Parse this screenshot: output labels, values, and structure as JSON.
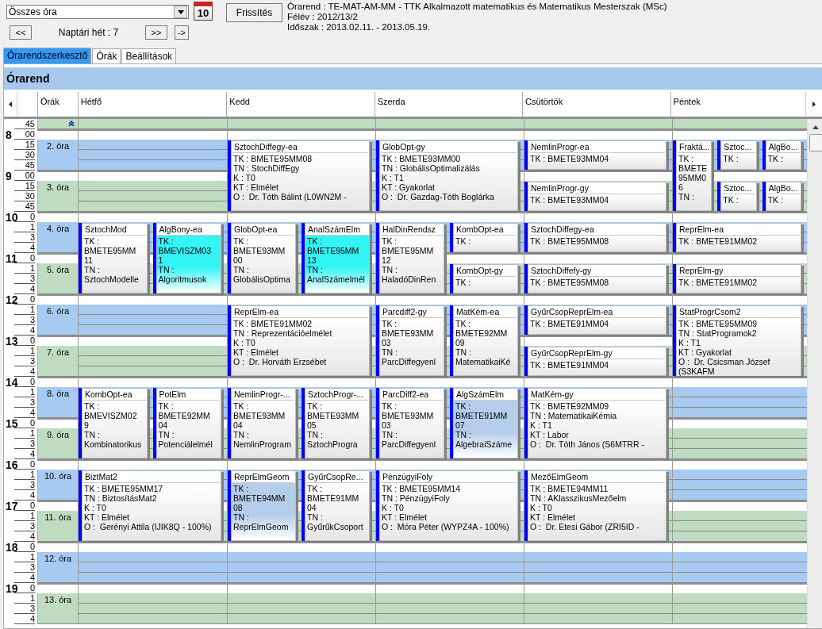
{
  "toolbar": {
    "filter": {
      "value": "Összes óra"
    },
    "calendar_button": {
      "label": "10"
    },
    "prev_button": "<<",
    "week_label": "Naptári hét : 7",
    "next_button": ">>",
    "go_button": "->",
    "refresh_button": "Frissítés",
    "info": [
      "Órarend : TE-MAT-AM-MM - TTK Alkalmazott matematikus és Matematikus Mesterszak (MSc)",
      "Félév : 2012/13/2",
      "Időszak : 2013.02.11. - 2013.05.19."
    ]
  },
  "tabs": [
    {
      "label": "Órarendszerkesztő",
      "selected": true
    },
    {
      "label": "Órák",
      "selected": false
    },
    {
      "label": "Beállítások",
      "selected": false
    }
  ],
  "panel_title": "Órarend",
  "columns": [
    "Órák",
    "Hétfő",
    "Kedd",
    "Szerda",
    "Csütörtök",
    "Péntek"
  ],
  "time_axis": [
    {
      "marks": [
        "45"
      ]
    },
    {
      "hour": "8",
      "marks": [
        "00",
        "15",
        "30",
        "45"
      ]
    },
    {
      "hour": "9",
      "marks": [
        "00",
        "15",
        "30",
        "45"
      ]
    },
    {
      "hour": "10",
      "marks": [
        "0",
        "1",
        "3",
        "4"
      ]
    },
    {
      "hour": "11",
      "marks": [
        "0",
        "1",
        "3",
        "4"
      ]
    },
    {
      "hour": "12",
      "marks": [
        "0",
        "1",
        "3",
        "4"
      ]
    },
    {
      "hour": "13",
      "marks": [
        "0",
        "1",
        "3",
        "4"
      ]
    },
    {
      "hour": "14",
      "marks": [
        "0",
        "1",
        "3",
        "4"
      ]
    },
    {
      "hour": "15",
      "marks": [
        "0",
        "1",
        "3",
        "4"
      ]
    },
    {
      "hour": "16",
      "marks": [
        "0",
        "1",
        "3",
        "4"
      ]
    },
    {
      "hour": "17",
      "marks": [
        "0",
        "1",
        "3",
        "4"
      ]
    },
    {
      "hour": "18",
      "marks": [
        "0",
        "1",
        "3",
        "4"
      ]
    },
    {
      "hour": "19",
      "marks": [
        "0",
        "1",
        "3",
        "4"
      ]
    }
  ],
  "periods": [
    {
      "kind": "partial",
      "color": "#c0dcc0"
    },
    {
      "kind": "full",
      "label": "2. óra",
      "color": "#a6caf0"
    },
    {
      "kind": "full",
      "label": "3. óra",
      "color": "#c0dcc0"
    },
    {
      "kind": "full",
      "label": "4. óra",
      "color": "#a6caf0"
    },
    {
      "kind": "full",
      "label": "5. óra",
      "color": "#c0dcc0"
    },
    {
      "kind": "full",
      "label": "6. óra",
      "color": "#a6caf0"
    },
    {
      "kind": "full",
      "label": "7. óra",
      "color": "#c0dcc0"
    },
    {
      "kind": "full",
      "label": "8. óra",
      "color": "#a6caf0"
    },
    {
      "kind": "full",
      "label": "9. óra",
      "color": "#c0dcc0"
    },
    {
      "kind": "full",
      "label": "10. óra",
      "color": "#a6caf0"
    },
    {
      "kind": "full",
      "label": "11. óra",
      "color": "#c0dcc0"
    },
    {
      "kind": "full",
      "label": "12. óra",
      "color": "#a6caf0"
    },
    {
      "kind": "full",
      "label": "13. óra",
      "color": "#c0dcc0"
    }
  ],
  "days": [
    {
      "blocks": [
        {
          "kind": "empty"
        },
        {
          "kind": "events",
          "lanes": [
            [
              {
                "kind": "double",
                "title": "SztochMod",
                "lines": [
                  "TK :",
                  "BMETE95MM",
                  "11",
                  "TN :",
                  "SztochModelle"
                ]
              }
            ],
            [
              {
                "kind": "double",
                "title": "AlgBony-ea",
                "color": "#33f5f5",
                "lines": [
                  "TK :",
                  "BMEVISZM03",
                  "1",
                  "TN :",
                  "Algoritmusok"
                ]
              }
            ]
          ]
        },
        {
          "kind": "empty"
        },
        {
          "kind": "events",
          "lanes": [
            [
              {
                "kind": "double",
                "title": "KombOpt-ea",
                "lines": [
                  "TK :",
                  "BMEVISZM02",
                  "9",
                  "TN :",
                  "Kombinatorikus"
                ]
              }
            ],
            [
              {
                "kind": "double",
                "title": "PotElm",
                "lines": [
                  "TK :",
                  "BMETE92MM",
                  "04",
                  "TN :",
                  "Potenciálelmél"
                ]
              }
            ]
          ]
        },
        {
          "kind": "events",
          "lanes": [
            [
              {
                "kind": "double",
                "title": "BiztMat2",
                "lines": [
                  "TK : BMETE95MM17",
                  "TN : BiztosításMat2",
                  "K : T0",
                  "KT : Elmélet",
                  "O :  Gerényi Attila (IJIK8Q - 100%)"
                ]
              }
            ]
          ]
        }
      ]
    },
    {
      "blocks": [
        {
          "kind": "events",
          "lanes": [
            [
              {
                "kind": "double",
                "title": "SztochDiffegy-ea",
                "lines": [
                  "TK : BMETE95MM08",
                  "TN : StochDiffEgy",
                  "K : T0",
                  "KT : Elmélet",
                  "O :  Dr. Tóth Bálint (L0WN2M -"
                ]
              }
            ]
          ]
        },
        {
          "kind": "events",
          "lanes": [
            [
              {
                "kind": "double",
                "title": "GlobOpt-ea",
                "lines": [
                  "TK :",
                  "BMETE93MM",
                  "00",
                  "TN :",
                  "GlobálisOptima"
                ]
              }
            ],
            [
              {
                "kind": "double",
                "title": "AnalSzámElm",
                "color": "#33f5f5",
                "lines": [
                  "TK :",
                  "BMETE95MM",
                  "13",
                  "TN :",
                  "AnalSzámelmél"
                ]
              }
            ]
          ]
        },
        {
          "kind": "events",
          "lanes": [
            [
              {
                "kind": "double",
                "title": "ReprElm-ea",
                "lines": [
                  "TK : BMETE91MM02",
                  "TN : Reprezentációelmélet",
                  "K : T0",
                  "KT : Elmélet",
                  "O :  Dr. Horváth Erzsébet"
                ]
              }
            ]
          ]
        },
        {
          "kind": "events",
          "lanes": [
            [
              {
                "kind": "double",
                "title": "NemlinProgr-...",
                "lines": [
                  "TK :",
                  "BMETE93MM",
                  "04",
                  "TN :",
                  "NemlinProgram"
                ]
              }
            ],
            [
              {
                "kind": "double",
                "title": "SztochProgr-...",
                "lines": [
                  "TK :",
                  "BMETE93MM",
                  "05",
                  "TN :",
                  "SztochProgra"
                ]
              }
            ]
          ]
        },
        {
          "kind": "events",
          "lanes": [
            [
              {
                "kind": "double",
                "title": "ReprElmGeom",
                "color": "#b4cdea",
                "lines": [
                  "TK :",
                  "BMETE94MM",
                  "08",
                  "TN :",
                  "ReprElmGeom"
                ]
              }
            ],
            [
              {
                "kind": "double",
                "title": "GyűrCsopRe...",
                "lines": [
                  "TK :",
                  "BMETE91MM",
                  "04",
                  "TN :",
                  "GyűrűkCsoport"
                ]
              }
            ]
          ]
        }
      ]
    },
    {
      "blocks": [
        {
          "kind": "events",
          "lanes": [
            [
              {
                "kind": "double",
                "title": "GlobOpt-gy",
                "lines": [
                  "TK : BMETE93MM00",
                  "TN : GlobálisOptimalizálás",
                  "K : T1",
                  "KT : Gyakorlat",
                  "O :  Dr. Gazdag-Tóth Boglárka"
                ]
              }
            ]
          ]
        },
        {
          "kind": "events",
          "lanes": [
            [
              {
                "kind": "double",
                "title": "HalDinRendsz",
                "lines": [
                  "TK :",
                  "BMETE95MM",
                  "12",
                  "TN :",
                  "HaladóDinRen"
                ]
              }
            ],
            [
              {
                "kind": "single",
                "title": "KombOpt-ea",
                "lines": [
                  "TK :"
                ]
              },
              {
                "kind": "single",
                "title": "KombOpt-gy",
                "lines": [
                  "TK :"
                ]
              }
            ]
          ]
        },
        {
          "kind": "events",
          "lanes": [
            [
              {
                "kind": "double",
                "title": "Parcdiff2-gy",
                "lines": [
                  "TK :",
                  "BMETE93MM",
                  "03",
                  "TN :",
                  "ParcDiffegyenl"
                ]
              }
            ],
            [
              {
                "kind": "double",
                "title": "MatKém-ea",
                "lines": [
                  "TK :",
                  "BMETE92MM",
                  "09",
                  "TN :",
                  "MatematikaiKé"
                ]
              }
            ]
          ]
        },
        {
          "kind": "events",
          "lanes": [
            [
              {
                "kind": "double",
                "title": "ParcDiff2-ea",
                "lines": [
                  "TK :",
                  "BMETE93MM",
                  "03",
                  "TN :",
                  "ParcDiffegyenl"
                ]
              }
            ],
            [
              {
                "kind": "double",
                "title": "AlgSzámElm",
                "color": "#b4cdea",
                "lines": [
                  "TK :",
                  "BMETE91MM",
                  "07",
                  "TN :",
                  "AlgebraiSzáme"
                ]
              }
            ]
          ]
        },
        {
          "kind": "events",
          "lanes": [
            [
              {
                "kind": "double",
                "title": "PénzügyiFoly",
                "lines": [
                  "TK : BMETE95MM14",
                  "TN : PénzügyiFoly",
                  "K : T0",
                  "KT : Elmélet",
                  "O :  Móra Péter (WYPZ4A - 100%)"
                ]
              }
            ]
          ]
        }
      ]
    },
    {
      "blocks": [
        {
          "kind": "events",
          "lanes": [
            [
              {
                "kind": "single",
                "title": "NemlinProgr-ea",
                "lines": [
                  "TK : BMETE93MM04"
                ]
              },
              {
                "kind": "single",
                "title": "NemlinProgr-gy",
                "lines": [
                  "TK : BMETE93MM04"
                ]
              }
            ]
          ]
        },
        {
          "kind": "events",
          "lanes": [
            [
              {
                "kind": "single",
                "title": "SztochDiffegy-ea",
                "lines": [
                  "TK : BMETE95MM08"
                ]
              },
              {
                "kind": "single",
                "title": "SztochDiffefy-gy",
                "lines": [
                  "TK : BMETE95MM08"
                ]
              }
            ]
          ]
        },
        {
          "kind": "events",
          "lanes": [
            [
              {
                "kind": "single",
                "title": "GyűrCsopReprElm-ea",
                "lines": [
                  "TK : BMETE91MM04"
                ]
              },
              {
                "kind": "single",
                "title": "GyűrCsopReprElm-gy",
                "lines": [
                  "TK : BMETE91MM04"
                ]
              }
            ]
          ]
        },
        {
          "kind": "events",
          "lanes": [
            [
              {
                "kind": "double",
                "title": "MatKém-gy",
                "lines": [
                  "TK : BMETE92MM09",
                  "TN : MatematikaiKémia",
                  "K : T1",
                  "KT : Labor",
                  "O :  Dr. Tóth János (S6MTRR -"
                ]
              }
            ]
          ]
        },
        {
          "kind": "events",
          "lanes": [
            [
              {
                "kind": "double",
                "title": "MezőElmGeom",
                "lines": [
                  "TK : BMETE94MM11",
                  "TN : AKlasszikusMezőelm",
                  "K : T0",
                  "KT : Elmélet",
                  "O :  Dr. Etesi Gábor (ZRI5ID -"
                ]
              }
            ]
          ]
        }
      ]
    },
    {
      "blocks": [
        {
          "kind": "events",
          "lanes": [
            [
              {
                "kind": "double",
                "title": "Fraktá...",
                "lines": [
                  "TK :",
                  "BMETE",
                  "95MM0",
                  "6",
                  "TN :"
                ]
              }
            ],
            [
              {
                "kind": "single",
                "title": "Sztoc...",
                "lines": [
                  "TK :"
                ]
              },
              {
                "kind": "single",
                "title": "Sztoc...",
                "lines": [
                  "TK :"
                ]
              }
            ],
            [
              {
                "kind": "single",
                "title": "AlgBo...",
                "lines": [
                  "TK :"
                ]
              },
              {
                "kind": "single",
                "title": "AlgBo...",
                "lines": [
                  "TK :"
                ]
              }
            ]
          ]
        },
        {
          "kind": "events",
          "lanes": [
            [
              {
                "kind": "single",
                "title": "ReprElm-ea",
                "lines": [
                  "TK : BMETE91MM02"
                ]
              },
              {
                "kind": "single",
                "title": "ReprElm-gy",
                "lines": [
                  "TK : BMETE91MM02"
                ]
              }
            ]
          ]
        },
        {
          "kind": "events",
          "lanes": [
            [
              {
                "kind": "double",
                "title": "StatProgrCsom2",
                "lines": [
                  "TK : BMETE95MM09",
                  "TN : StatProgramok2",
                  "K : T1",
                  "KT : Gyakorlat",
                  "O :  Dr. Csicsman József (S3KAFM"
                ]
              }
            ]
          ]
        }
      ]
    }
  ]
}
